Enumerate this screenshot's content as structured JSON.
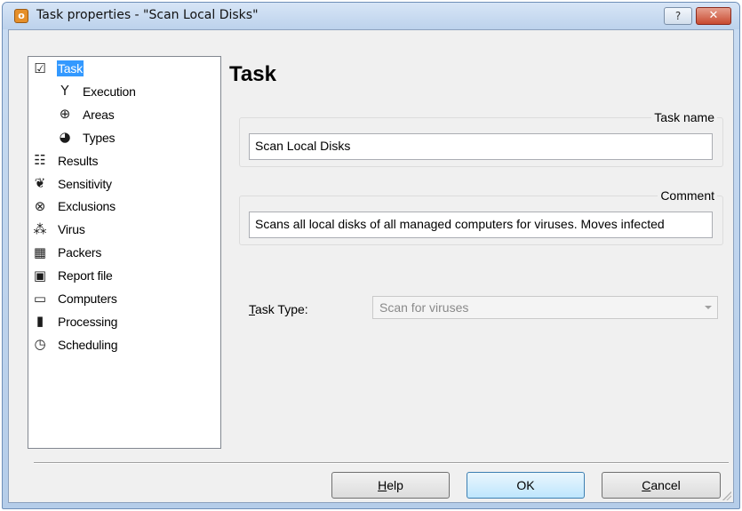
{
  "window": {
    "title": "Task properties - \"Scan Local Disks\"",
    "help_button": "?",
    "close_button": "✕"
  },
  "tree": {
    "selected": "Task",
    "items": [
      {
        "label": "Task",
        "icon": "clipboard-check-icon",
        "glyph": "☑",
        "level": 0
      },
      {
        "label": "Execution",
        "icon": "branch-icon",
        "glyph": "Y",
        "level": 1
      },
      {
        "label": "Areas",
        "icon": "globe-icon",
        "glyph": "⊕",
        "level": 1
      },
      {
        "label": "Types",
        "icon": "types-icon",
        "glyph": "◕",
        "level": 1
      },
      {
        "label": "Results",
        "icon": "results-checklist-icon",
        "glyph": "☷",
        "level": 0
      },
      {
        "label": "Sensitivity",
        "icon": "feather-icon",
        "glyph": "❦",
        "level": 0
      },
      {
        "label": "Exclusions",
        "icon": "exclusion-circle-x-icon",
        "glyph": "⊗",
        "level": 0
      },
      {
        "label": "Virus",
        "icon": "virus-icon",
        "glyph": "⁂",
        "level": 0
      },
      {
        "label": "Packers",
        "icon": "packers-icon",
        "glyph": "▦",
        "level": 0
      },
      {
        "label": "Report file",
        "icon": "report-file-icon",
        "glyph": "▣",
        "level": 0
      },
      {
        "label": "Computers",
        "icon": "monitor-icon",
        "glyph": "▭",
        "level": 0
      },
      {
        "label": "Processing",
        "icon": "bar-chart-icon",
        "glyph": "▮",
        "level": 0
      },
      {
        "label": "Scheduling",
        "icon": "clock-icon",
        "glyph": "◷",
        "level": 0
      }
    ]
  },
  "main": {
    "heading": "Task",
    "task_name": {
      "label": "Task name",
      "value": "Scan Local Disks"
    },
    "comment": {
      "label": "Comment",
      "value": "Scans all local disks of all managed computers for viruses. Moves infected"
    },
    "task_type": {
      "label_prefix": "T",
      "label_rest": "ask Type:",
      "selected": "Scan for viruses"
    }
  },
  "buttons": {
    "help": {
      "prefix": "H",
      "rest": "elp"
    },
    "ok": "OK",
    "cancel": {
      "prefix": "C",
      "rest": "ancel"
    }
  },
  "colors": {
    "selection": "#3399ff",
    "title_bar": "#c9dcf2",
    "close_button": "#c84a30",
    "dialog_background": "#f0f0f0"
  }
}
